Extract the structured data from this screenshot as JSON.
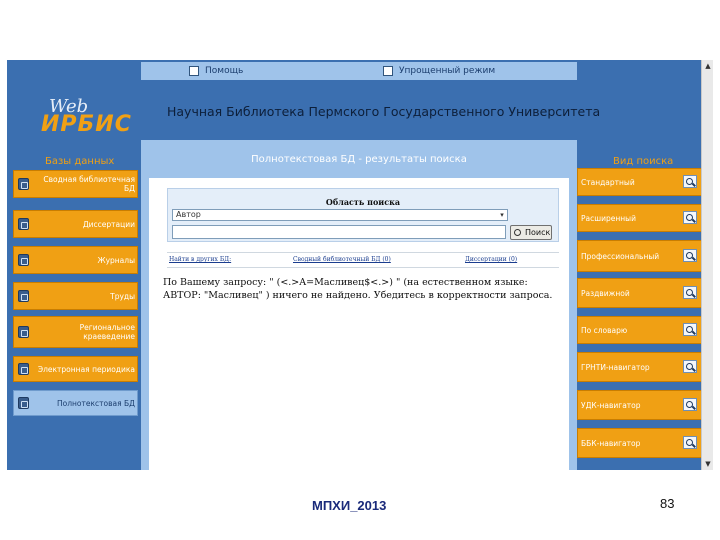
{
  "logo": {
    "line1": "Web",
    "line2": "ИРБИС"
  },
  "top_bar": {
    "link1": "Помощь",
    "link2": "Упрощенный режим"
  },
  "site_title": "Научная Библиотека Пермского Государственного Университета",
  "left_title": "Базы данных",
  "left_menu": [
    "Сводная библиотечная БД",
    "Диссертации",
    "Журналы",
    "Труды",
    "Региональное краеведение",
    "Электронная периодика",
    "Полнотекстовая БД"
  ],
  "center_title": "Полнотекстовая БД - результаты поиска",
  "search": {
    "area_label": "Область поиска",
    "area_value": "Автор",
    "input_value": "",
    "button_label": "Поиск"
  },
  "db_links": [
    "Найти в других БД:",
    "Сводный библиотечный БД (0)",
    "Диссертации (0)"
  ],
  "result_text": "По Вашему запросу: \" (<.>A=Масливец$<.>) \" (на естественном языке: АВТОР: \"Масливец\" ) ничего не найдено. Убедитесь в корректности запроса.",
  "right_title": "Вид поиска",
  "right_menu": [
    "Стандартный",
    "Расширенный",
    "Профессиональный",
    "Раздвижной",
    "По словарю",
    "ГРНТИ-навигатор",
    "УДК-навигатор",
    "ББК-навигатор"
  ],
  "footer": {
    "label": "МПХИ_2013",
    "page": "83"
  },
  "colors": {
    "background": "#3b6fb0",
    "accent": "#f0a014",
    "panel": "#9fc3ea"
  }
}
